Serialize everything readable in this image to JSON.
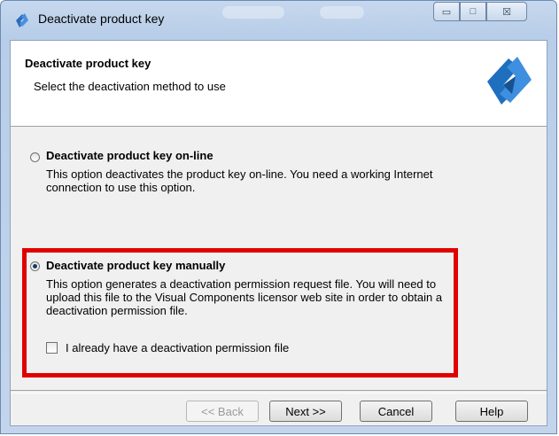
{
  "window": {
    "title": "Deactivate product key",
    "controls": {
      "minimize": "▭",
      "maximize": "□",
      "close": "☒"
    }
  },
  "header": {
    "title": "Deactivate product key",
    "subtitle": "Select the deactivation method to use"
  },
  "options": [
    {
      "label": "Deactivate product key on-line",
      "description": "This option deactivates the product key on-line. You need a working Internet connection to use this option.",
      "selected": false
    },
    {
      "label": "Deactivate product key manually",
      "description": "This option generates a deactivation permission request file. You will need to upload this file to the Visual Components licensor web site in order to obtain a deactivation permission file.",
      "selected": true
    }
  ],
  "checkbox": {
    "label": "I already have a deactivation permission file",
    "checked": false
  },
  "buttons": {
    "back": "<< Back",
    "next": "Next >>",
    "cancel": "Cancel",
    "help": "Help"
  },
  "colors": {
    "highlight": "#e00000",
    "logo": "#1f6fbf"
  },
  "icons": {
    "app": "app-logo-icon",
    "logo": "app-logo-icon"
  }
}
